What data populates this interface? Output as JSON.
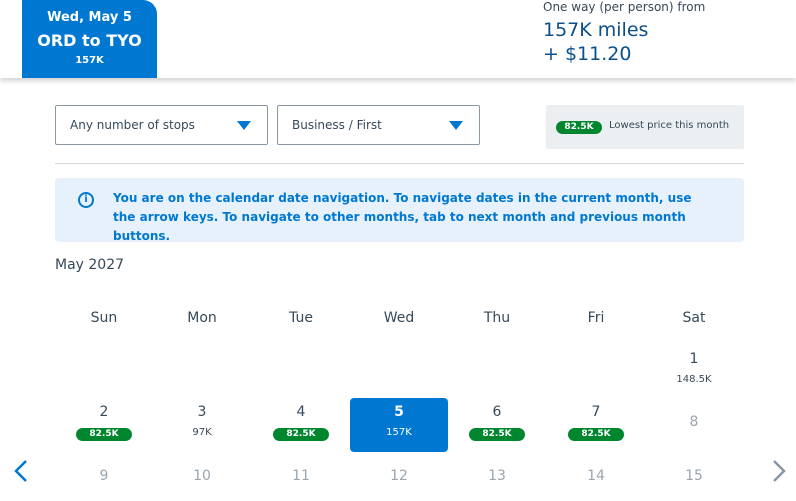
{
  "header": {
    "tab": {
      "date": "Wed, May 5",
      "route": "ORD to TYO",
      "miles": "157K"
    },
    "fare": {
      "label": "One way (per person) from",
      "miles": "157K miles",
      "cash": "+ $11.20"
    }
  },
  "filters": {
    "stops": "Any number of stops",
    "cabin": "Business / First"
  },
  "legend": {
    "pill": "82.5K",
    "text": "Lowest price this month"
  },
  "info": {
    "icon": "i",
    "text": "You are on the calendar date navigation. To navigate dates in the current month, use the arrow keys. To navigate to other months, tab to next month and previous month buttons."
  },
  "calendar": {
    "month": "May 2027",
    "weekdays": [
      "Sun",
      "Mon",
      "Tue",
      "Wed",
      "Thu",
      "Fri",
      "Sat"
    ],
    "days": [
      {
        "day": "1",
        "price": "148.5K",
        "lowest": false
      },
      {
        "day": "2",
        "price": "82.5K",
        "lowest": true
      },
      {
        "day": "3",
        "price": "97K",
        "lowest": false
      },
      {
        "day": "4",
        "price": "82.5K",
        "lowest": true
      },
      {
        "day": "5",
        "price": "157K",
        "lowest": false,
        "selected": true
      },
      {
        "day": "6",
        "price": "82.5K",
        "lowest": true
      },
      {
        "day": "7",
        "price": "82.5K",
        "lowest": true
      },
      {
        "day": "8",
        "price": ""
      },
      {
        "day": "9",
        "price": ""
      },
      {
        "day": "10",
        "price": ""
      },
      {
        "day": "11",
        "price": ""
      },
      {
        "day": "12",
        "price": ""
      },
      {
        "day": "13",
        "price": ""
      },
      {
        "day": "14",
        "price": ""
      },
      {
        "day": "15",
        "price": ""
      }
    ]
  },
  "icons": {
    "prev": "chevron-left-icon",
    "next": "chevron-right-icon",
    "info": "info-icon",
    "caret": "chevron-down-icon"
  },
  "colors": {
    "primary": "#0078d2",
    "lowest": "#00862f",
    "text": "#36495a"
  }
}
